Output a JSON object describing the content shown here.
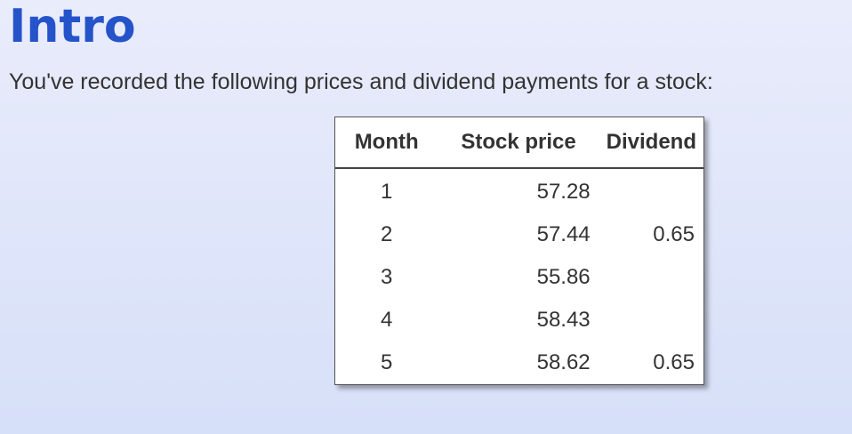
{
  "header": {
    "title": "Intro",
    "description": "You've recorded the following prices and dividend payments for a stock:"
  },
  "table": {
    "columns": [
      "Month",
      "Stock price",
      "Dividend"
    ],
    "rows": [
      {
        "month": "1",
        "price": "57.28",
        "dividend": ""
      },
      {
        "month": "2",
        "price": "57.44",
        "dividend": "0.65"
      },
      {
        "month": "3",
        "price": "55.86",
        "dividend": ""
      },
      {
        "month": "4",
        "price": "58.43",
        "dividend": ""
      },
      {
        "month": "5",
        "price": "58.62",
        "dividend": "0.65"
      }
    ]
  },
  "colors": {
    "title": "#2553c9",
    "text": "#333333",
    "background": "#e3e8fa"
  }
}
